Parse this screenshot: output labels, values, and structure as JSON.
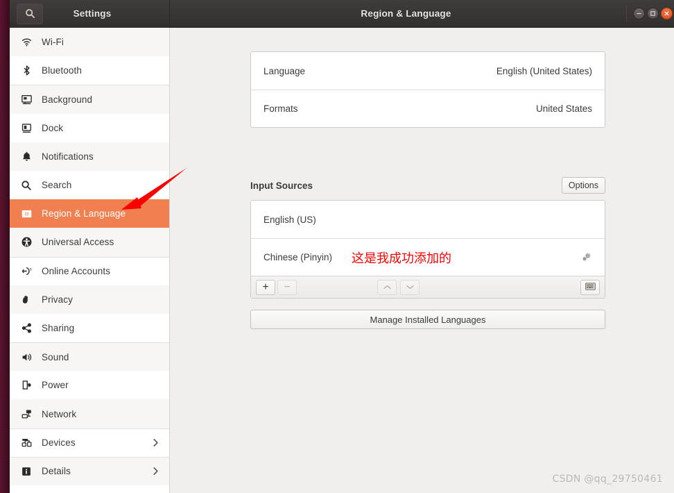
{
  "window": {
    "sidebar_title": "Settings",
    "main_title": "Region & Language",
    "search_icon": "search-icon",
    "controls": {
      "minimize": "minimize-icon",
      "maximize": "maximize-icon",
      "close": "close-icon"
    }
  },
  "sidebar": {
    "items": [
      {
        "label": "Wi-Fi",
        "icon": "wifi-icon",
        "chevron": false
      },
      {
        "label": "Bluetooth",
        "icon": "bluetooth-icon",
        "chevron": false
      },
      {
        "label": "Background",
        "icon": "background-icon",
        "chevron": false
      },
      {
        "label": "Dock",
        "icon": "dock-icon",
        "chevron": false
      },
      {
        "label": "Notifications",
        "icon": "bell-icon",
        "chevron": false
      },
      {
        "label": "Search",
        "icon": "search-icon",
        "chevron": false
      },
      {
        "label": "Region & Language",
        "icon": "region-language-icon",
        "chevron": false,
        "active": true
      },
      {
        "label": "Universal Access",
        "icon": "accessibility-icon",
        "chevron": false
      },
      {
        "label": "Online Accounts",
        "icon": "online-accounts-icon",
        "chevron": false
      },
      {
        "label": "Privacy",
        "icon": "hand-privacy-icon",
        "chevron": false
      },
      {
        "label": "Sharing",
        "icon": "share-icon",
        "chevron": false
      },
      {
        "label": "Sound",
        "icon": "speaker-icon",
        "chevron": false
      },
      {
        "label": "Power",
        "icon": "power-battery-icon",
        "chevron": false
      },
      {
        "label": "Network",
        "icon": "network-icon",
        "chevron": false
      },
      {
        "label": "Devices",
        "icon": "devices-icon",
        "chevron": true
      },
      {
        "label": "Details",
        "icon": "info-icon",
        "chevron": true
      }
    ]
  },
  "main": {
    "language_row": {
      "label": "Language",
      "value": "English (United States)"
    },
    "formats_row": {
      "label": "Formats",
      "value": "United States"
    },
    "input_sources": {
      "title": "Input Sources",
      "options_button": "Options",
      "sources": [
        {
          "name": "English (US)",
          "annotation": "",
          "gear": false
        },
        {
          "name": "Chinese (Pinyin)",
          "annotation": "这是我成功添加的",
          "gear": true
        }
      ],
      "toolbar": {
        "add": "+",
        "remove": "−",
        "move_up": "move-up-icon",
        "move_down": "move-down-icon",
        "show_keyboard": "keyboard-icon"
      }
    },
    "manage_button": "Manage Installed Languages"
  },
  "annotation": {
    "arrow_color": "#fb0000",
    "text_color": "#fb0000"
  },
  "watermark": "CSDN @qq_29750461",
  "colors": {
    "accent_orange": "#f08050",
    "titlebar": "#393534",
    "content_bg": "#f0efee",
    "close_button": "#e2552a"
  }
}
